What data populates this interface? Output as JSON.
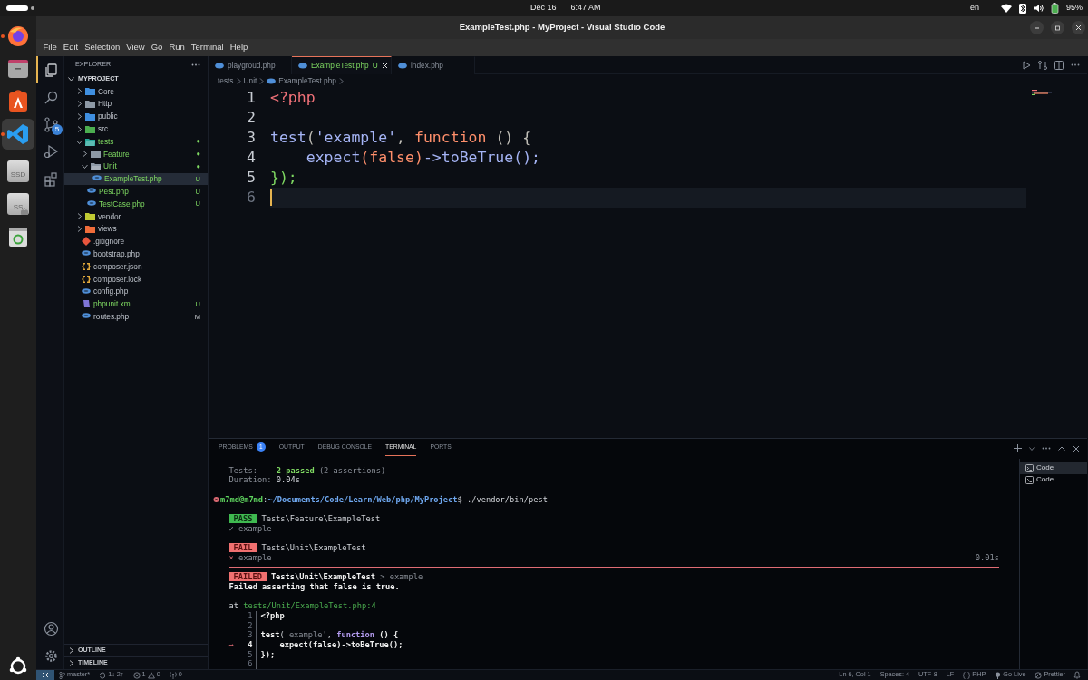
{
  "top_bar": {
    "date": "Dec 16",
    "time": "6:47 AM",
    "input_source": "en",
    "battery": "95%"
  },
  "dock": [
    {
      "kind": "firefox",
      "running": true,
      "selected": false
    },
    {
      "kind": "files",
      "running": false,
      "selected": false
    },
    {
      "kind": "app-center",
      "running": false,
      "selected": false
    },
    {
      "kind": "vscode",
      "running": true,
      "selected": true
    },
    {
      "kind": "drive",
      "label": "SSD",
      "running": false,
      "selected": false
    },
    {
      "kind": "drive-locked",
      "label": "SS",
      "running": false,
      "selected": false
    },
    {
      "kind": "trash",
      "running": false,
      "selected": false
    }
  ],
  "window": {
    "title": "ExampleTest.php - MyProject - Visual Studio Code"
  },
  "menu": [
    "File",
    "Edit",
    "Selection",
    "View",
    "Go",
    "Run",
    "Terminal",
    "Help"
  ],
  "activity_bar": [
    {
      "kind": "explorer",
      "selected": true
    },
    {
      "kind": "search",
      "selected": false
    },
    {
      "kind": "source-control",
      "selected": false,
      "badge": "5"
    },
    {
      "kind": "run-debug",
      "selected": false
    },
    {
      "kind": "extensions",
      "selected": false
    }
  ],
  "activity_bar_bottom": [
    {
      "kind": "accounts"
    },
    {
      "kind": "settings"
    }
  ],
  "explorer": {
    "title": "EXPLORER",
    "project": "MYPROJECT",
    "tree": [
      {
        "name": "Core",
        "kind": "folder",
        "color": "#3f8fe0",
        "expanded": false,
        "selected": false,
        "untracked": false
      },
      {
        "name": "Http",
        "kind": "folder",
        "color": "#8d99a6",
        "expanded": false,
        "selected": false,
        "untracked": false
      },
      {
        "name": "public",
        "kind": "folder",
        "color": "#3f8fe0",
        "expanded": false,
        "selected": false,
        "untracked": false
      },
      {
        "name": "src",
        "kind": "folder",
        "color": "#4caf50",
        "expanded": false,
        "selected": false,
        "untracked": false
      },
      {
        "name": "tests",
        "kind": "folder",
        "color": "#26a69a",
        "expanded": true,
        "selected": false,
        "untracked": true,
        "decoration": "●",
        "children": [
          {
            "name": "Feature",
            "kind": "folder",
            "color": "#8d99a6",
            "expanded": false,
            "selected": false,
            "untracked": true,
            "decoration": "●"
          },
          {
            "name": "Unit",
            "kind": "folder",
            "color": "#8d99a6",
            "expanded": true,
            "selected": false,
            "untracked": true,
            "decoration": "●",
            "children": [
              {
                "name": "ExampleTest.php",
                "kind": "php",
                "color": "#4f8fd8",
                "selected": true,
                "untracked": true,
                "decoration": "U"
              }
            ]
          },
          {
            "name": "Pest.php",
            "kind": "php",
            "color": "#4f8fd8",
            "selected": false,
            "untracked": true,
            "decoration": "U"
          },
          {
            "name": "TestCase.php",
            "kind": "php",
            "color": "#4f8fd8",
            "selected": false,
            "untracked": true,
            "decoration": "U"
          }
        ]
      },
      {
        "name": "vendor",
        "kind": "folder",
        "color": "#c0ca33",
        "expanded": false,
        "selected": false,
        "untracked": false
      },
      {
        "name": "views",
        "kind": "folder",
        "color": "#ef6c3a",
        "expanded": false,
        "selected": false,
        "untracked": false
      },
      {
        "name": ".gitignore",
        "kind": "git",
        "color": "#e8553d",
        "selected": false,
        "untracked": false
      },
      {
        "name": "bootstrap.php",
        "kind": "php",
        "color": "#4f8fd8",
        "selected": false,
        "untracked": false
      },
      {
        "name": "composer.json",
        "kind": "braces",
        "color": "#e2a93b",
        "selected": false,
        "untracked": false
      },
      {
        "name": "composer.lock",
        "kind": "braces",
        "color": "#e2a93b",
        "selected": false,
        "untracked": false
      },
      {
        "name": "config.php",
        "kind": "php",
        "color": "#4f8fd8",
        "selected": false,
        "untracked": false
      },
      {
        "name": "phpunit.xml",
        "kind": "xml",
        "color": "#7e74d6",
        "selected": false,
        "untracked": true,
        "decoration": "U"
      },
      {
        "name": "routes.php",
        "kind": "php",
        "color": "#4f8fd8",
        "selected": false,
        "untracked": false,
        "decoration": "M"
      }
    ],
    "sections": [
      "OUTLINE",
      "TIMELINE"
    ]
  },
  "editor": {
    "tabs": [
      {
        "label": "playgroud.php",
        "selected": false,
        "untracked": false
      },
      {
        "label": "ExampleTest.php",
        "selected": true,
        "untracked": true,
        "decoration": "U"
      },
      {
        "label": "index.php",
        "selected": false,
        "untracked": false
      }
    ],
    "breadcrumbs": [
      "tests",
      "Unit",
      "ExampleTest.php",
      "…"
    ],
    "lines": [
      {
        "no": "1",
        "current": false,
        "tokens": [
          {
            "text": "<?php",
            "kind": "tag"
          }
        ]
      },
      {
        "no": "2",
        "current": false
      },
      {
        "no": "3",
        "current": false,
        "tokens": [
          {
            "text": "test",
            "kind": "fn"
          },
          {
            "text": "(",
            "kind": "punct"
          },
          {
            "text": "'example'",
            "kind": "fn"
          },
          {
            "text": ", ",
            "kind": "punct"
          },
          {
            "text": "function",
            "kind": "kw"
          },
          {
            "text": " () {",
            "kind": "punct"
          }
        ]
      },
      {
        "no": "4",
        "current": false,
        "tokens": [
          {
            "text": "    expect",
            "kind": "fn"
          },
          {
            "text": "(false)",
            "kind": "kw"
          },
          {
            "text": "->toBeTrue();",
            "kind": "fn"
          }
        ]
      },
      {
        "no": "5",
        "current": false,
        "tokens": [
          {
            "text": "});",
            "kind": "close"
          }
        ]
      },
      {
        "no": "6",
        "current": true
      }
    ]
  },
  "panel": {
    "tabs": [
      {
        "label": "PROBLEMS",
        "selected": false,
        "badge": "1"
      },
      {
        "label": "OUTPUT",
        "selected": false
      },
      {
        "label": "DEBUG CONSOLE",
        "selected": false
      },
      {
        "label": "TERMINAL",
        "selected": true
      },
      {
        "label": "PORTS",
        "selected": false
      }
    ],
    "terminal": [
      {
        "kind": "text",
        "segs": [
          {
            "text": "Tests:    ",
            "kind": "dim"
          },
          {
            "text": "2 passed",
            "kind": "pass"
          },
          {
            "text": " (2 assertions)",
            "kind": "dim"
          }
        ]
      },
      {
        "kind": "text",
        "segs": [
          {
            "text": "Duration: ",
            "kind": "dim"
          },
          {
            "text": "0.04s",
            "kind": "plain"
          }
        ]
      },
      {
        "kind": "gap"
      },
      {
        "kind": "prompt",
        "segs": [
          {
            "text": "m7md@m7md",
            "kind": "user"
          },
          {
            "text": ":",
            "kind": "plain"
          },
          {
            "text": "~/Documents/Code/Learn/Web/php/MyProject",
            "kind": "cwd"
          },
          {
            "text": "$ ./vendor/bin/pest",
            "kind": "plain"
          }
        ]
      },
      {
        "kind": "gap"
      },
      {
        "kind": "text",
        "segs": [
          {
            "text": "PASS",
            "kind": "pass-badge"
          },
          {
            "text": "Tests\\Feature\\ExampleTest",
            "kind": "plain"
          }
        ]
      },
      {
        "kind": "text",
        "segs": [
          {
            "text": "✓ example",
            "kind": "dim"
          }
        ]
      },
      {
        "kind": "gap"
      },
      {
        "kind": "text",
        "segs": [
          {
            "text": "FAIL",
            "kind": "fail-badge"
          },
          {
            "text": "Tests\\Unit\\ExampleTest",
            "kind": "plain"
          }
        ]
      },
      {
        "kind": "text",
        "segs": [
          {
            "text": "×",
            "kind": "fail-mark"
          },
          {
            "text": " example",
            "kind": "dim"
          }
        ],
        "right": "0.01s"
      },
      {
        "kind": "rule"
      },
      {
        "kind": "text",
        "segs": [
          {
            "text": "FAILED",
            "kind": "fail-badge"
          },
          {
            "text": "Tests\\Unit\\ExampleTest",
            "kind": "bold"
          },
          {
            "text": " > example",
            "kind": "dim"
          }
        ]
      },
      {
        "kind": "text",
        "segs": [
          {
            "text": "Failed asserting that false is true.",
            "kind": "bold"
          }
        ]
      },
      {
        "kind": "gap"
      },
      {
        "kind": "text",
        "segs": [
          {
            "text": "at ",
            "kind": "plain"
          },
          {
            "text": "tests/Unit/ExampleTest.php:4",
            "kind": "file"
          }
        ]
      },
      {
        "kind": "excerpt",
        "no": "1",
        "current": false,
        "segs": [
          {
            "text": "<?php",
            "kind": "bold"
          }
        ]
      },
      {
        "kind": "excerpt",
        "no": "2",
        "current": false
      },
      {
        "kind": "excerpt",
        "no": "3",
        "current": false,
        "segs": [
          {
            "text": "test",
            "kind": "bold"
          },
          {
            "text": "(",
            "kind": "plain"
          },
          {
            "text": "'example'",
            "kind": "dim"
          },
          {
            "text": ", ",
            "kind": "plain"
          },
          {
            "text": "function",
            "kind": "kw"
          },
          {
            "text": " () {",
            "kind": "bold"
          }
        ]
      },
      {
        "kind": "excerpt",
        "no": "4",
        "current": true,
        "marker": "→",
        "segs": [
          {
            "text": "    expect(false)->toBeTrue();",
            "kind": "bold"
          }
        ]
      },
      {
        "kind": "excerpt",
        "no": "5",
        "current": false,
        "segs": [
          {
            "text": "});",
            "kind": "bold"
          }
        ]
      },
      {
        "kind": "excerpt",
        "no": "6",
        "current": false
      }
    ],
    "terminals": [
      {
        "label": "Code",
        "selected": true
      },
      {
        "label": "Code",
        "selected": false
      }
    ]
  },
  "status_bar": {
    "branch": "master*",
    "sync": "1↓ 2↑",
    "errors": "1",
    "warnings": "0",
    "ports": "0",
    "position": "Ln 6, Col 1",
    "indent": "Spaces: 4",
    "encoding": "UTF-8",
    "eol": "LF",
    "language": "PHP",
    "live": "Go Live",
    "formatter": "Prettier"
  }
}
